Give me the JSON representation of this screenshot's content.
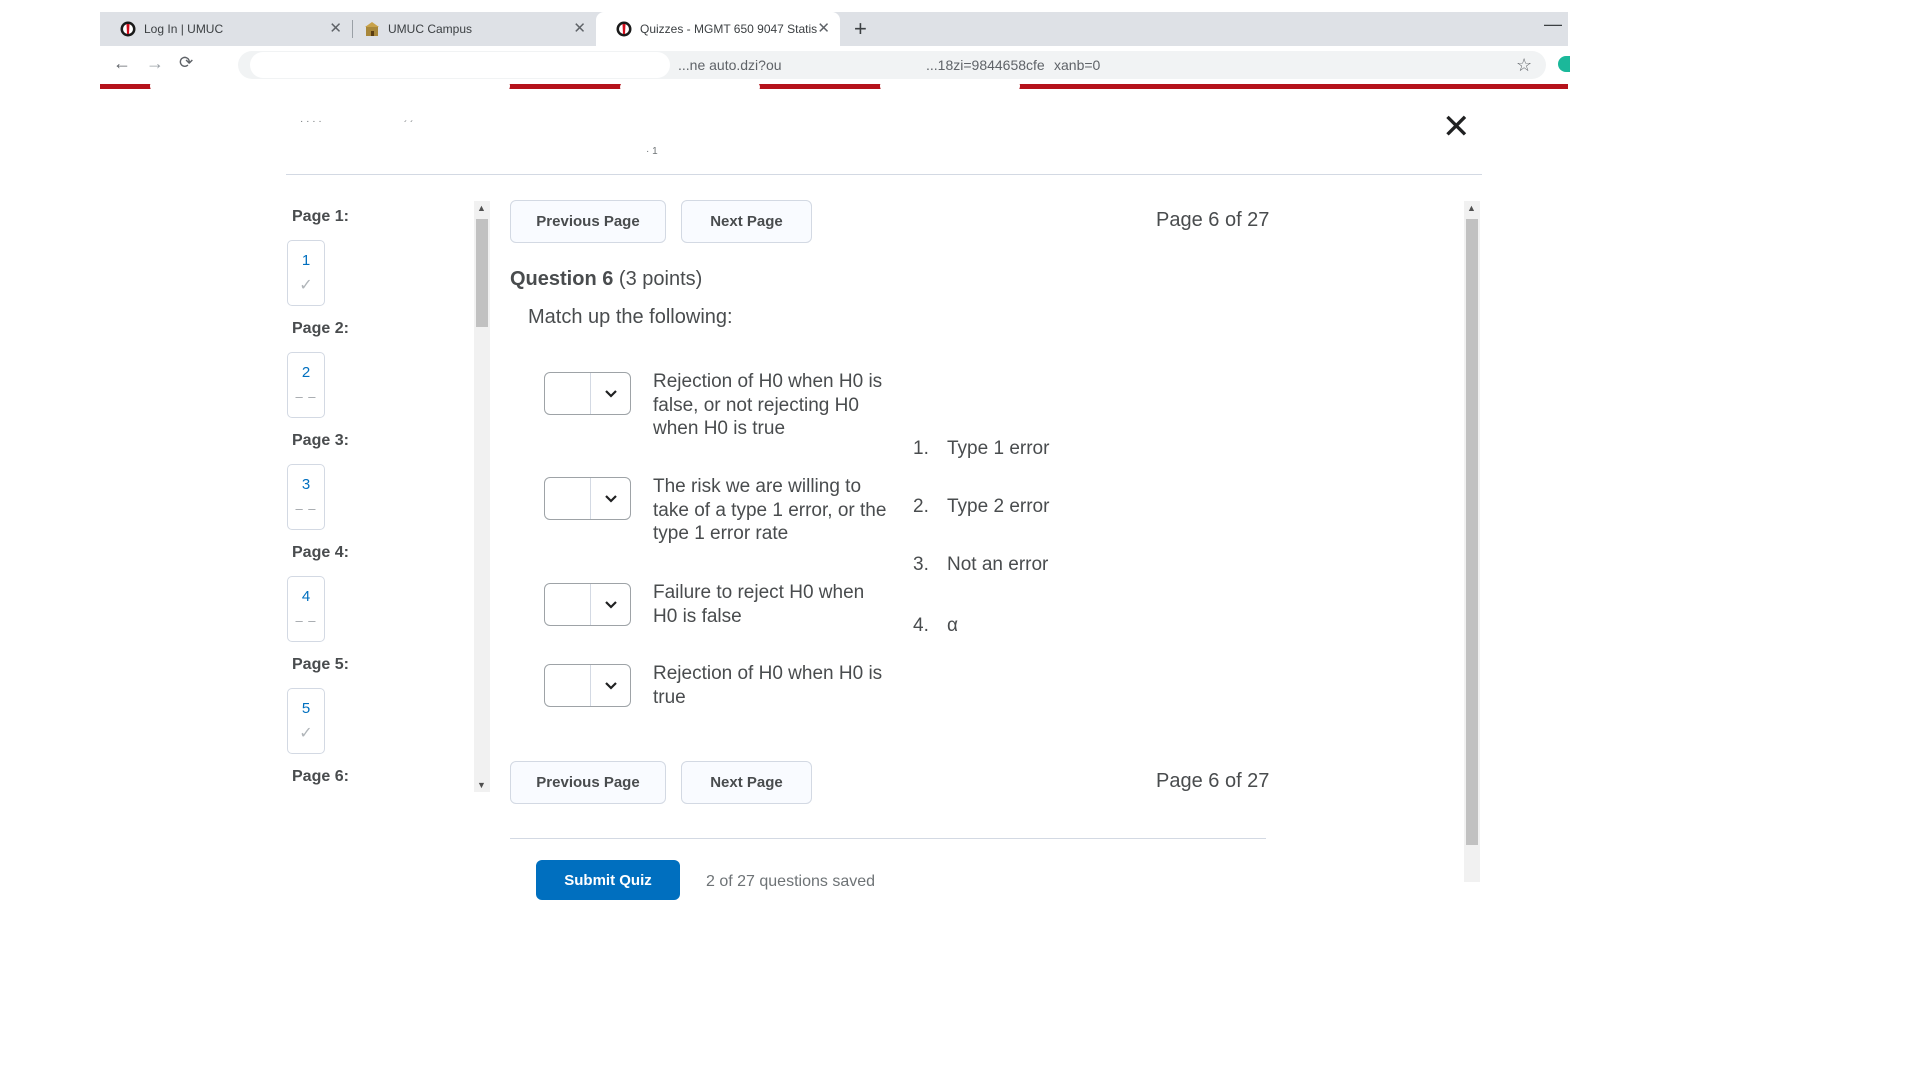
{
  "browser": {
    "tabs": [
      {
        "title": "Log In | UMUC",
        "icon": "umuc-logo-icon"
      },
      {
        "title": "UMUC Campus",
        "icon": "campus-building-icon"
      },
      {
        "title": "Quizzes - MGMT 650 9047 Statis",
        "icon": "umuc-logo-icon"
      }
    ],
    "url_fragment": "xanb=0",
    "url_partial": "...ne auto.dzi?ou",
    "url_partial_2": "...18zi=9844658cfe"
  },
  "quiz": {
    "close_label": "✕",
    "sidebar": {
      "pages": [
        {
          "label": "Page 1:",
          "number": "1",
          "status": "answered"
        },
        {
          "label": "Page 2:",
          "number": "2",
          "status": "unanswered"
        },
        {
          "label": "Page 3:",
          "number": "3",
          "status": "unanswered"
        },
        {
          "label": "Page 4:",
          "number": "4",
          "status": "unanswered"
        },
        {
          "label": "Page 5:",
          "number": "5",
          "status": "answered"
        },
        {
          "label": "Page 6:"
        }
      ]
    },
    "nav": {
      "previous": "Previous Page",
      "next": "Next Page",
      "page_indicator": "Page 6 of 27"
    },
    "question": {
      "number_label": "Question 6",
      "points": "(3 points)",
      "prompt": "Match up the following:",
      "statements": [
        "Rejection of H0 when H0 is false, or not rejecting H0 when H0 is true",
        "The risk we are willing to take of a type 1 error, or the type 1 error rate",
        "Failure to reject H0 when H0 is false",
        "Rejection of H0 when H0 is true"
      ],
      "choices": [
        {
          "n": "1.",
          "text": "Type 1 error"
        },
        {
          "n": "2.",
          "text": "Type 2 error"
        },
        {
          "n": "3.",
          "text": "Not an error"
        },
        {
          "n": "4.",
          "text": "α"
        }
      ]
    },
    "footer": {
      "submit": "Submit Quiz",
      "answered": "2 of 27 questions saved"
    }
  },
  "colors": {
    "link": "#006fbf",
    "submit": "#006fbf",
    "accent_bar": "#b5121b"
  }
}
